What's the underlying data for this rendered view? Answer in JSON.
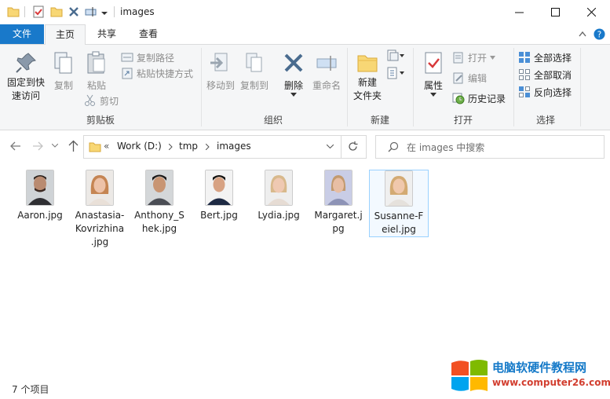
{
  "window": {
    "title": "images",
    "minimize_label": "─",
    "maximize_label": "☐",
    "close_label": "✕"
  },
  "tabs": {
    "file": "文件",
    "home": "主页",
    "share": "共享",
    "view": "查看"
  },
  "ribbon": {
    "clipboard": {
      "group": "剪贴板",
      "pin": "固定到快\n速访问",
      "copy": "复制",
      "paste": "粘贴",
      "copy_path": "复制路径",
      "paste_shortcut": "粘贴快捷方式",
      "cut": "剪切"
    },
    "organize": {
      "group": "组织",
      "move_to": "移动到",
      "copy_to": "复制到",
      "delete": "删除",
      "rename": "重命名"
    },
    "new": {
      "group": "新建",
      "new_folder": "新建\n文件夹"
    },
    "open": {
      "group": "打开",
      "properties": "属性",
      "open": "打开",
      "edit": "编辑",
      "history": "历史记录"
    },
    "select": {
      "group": "选择",
      "select_all": "全部选择",
      "select_none": "全部取消",
      "invert": "反向选择"
    }
  },
  "address": {
    "chevron": "«",
    "crumbs": [
      "Work (D:)",
      "tmp",
      "images"
    ],
    "search_placeholder": "在 images 中搜索"
  },
  "files": [
    {
      "name": "Aaron.jpg",
      "selected": false
    },
    {
      "name": "Anastasia-\nKovrizhina\n.jpg",
      "selected": false
    },
    {
      "name": "Anthony_S\nhek.jpg",
      "selected": false
    },
    {
      "name": "Bert.jpg",
      "selected": false
    },
    {
      "name": "Lydia.jpg",
      "selected": false
    },
    {
      "name": "Margaret.j\npg",
      "selected": false
    },
    {
      "name": "Susanne-F\neiel.jpg",
      "selected": true
    }
  ],
  "status": {
    "count": "7 个项目"
  },
  "watermark": {
    "title": "电脑软硬件教程网",
    "url": "www.computer26.com"
  },
  "colors": {
    "accent": "#1979ca",
    "ribbon_bg": "#f5f6f7",
    "selection_border": "#99d1ff"
  }
}
